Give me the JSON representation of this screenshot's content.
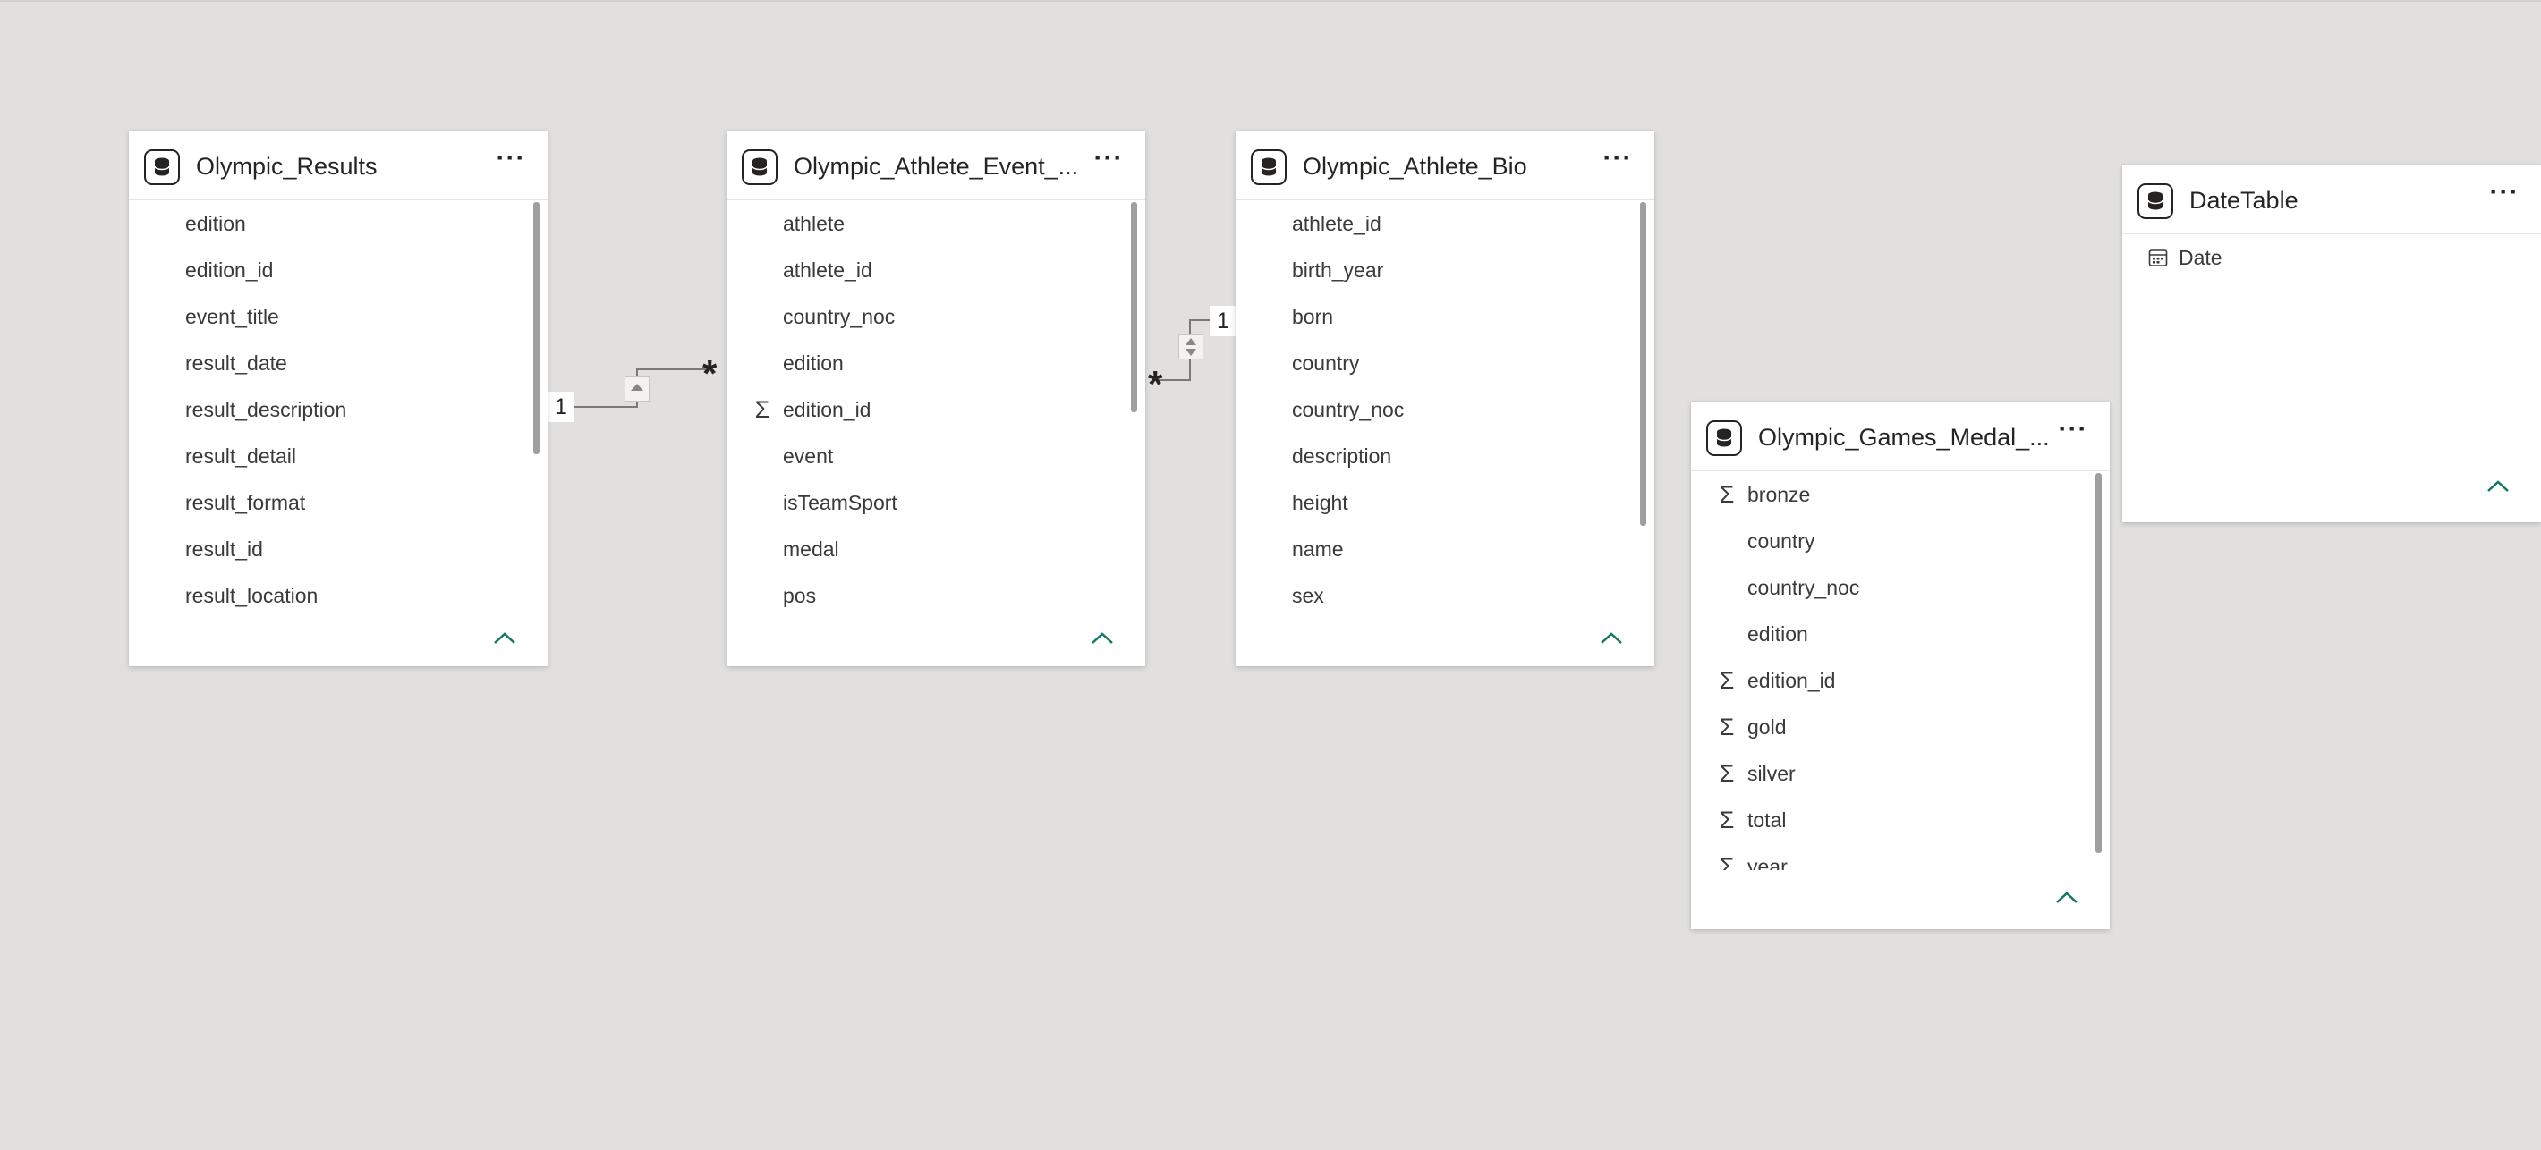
{
  "tables": [
    {
      "title": "Olympic_Results",
      "icon": "table-icon",
      "fields": [
        {
          "name": "edition",
          "icon": ""
        },
        {
          "name": "edition_id",
          "icon": ""
        },
        {
          "name": "event_title",
          "icon": ""
        },
        {
          "name": "result_date",
          "icon": ""
        },
        {
          "name": "result_description",
          "icon": ""
        },
        {
          "name": "result_detail",
          "icon": ""
        },
        {
          "name": "result_format",
          "icon": ""
        },
        {
          "name": "result_id",
          "icon": ""
        },
        {
          "name": "result_location",
          "icon": ""
        }
      ]
    },
    {
      "title": "Olympic_Athlete_Event_...",
      "icon": "table-icon",
      "fields": [
        {
          "name": "athlete",
          "icon": ""
        },
        {
          "name": "athlete_id",
          "icon": ""
        },
        {
          "name": "country_noc",
          "icon": ""
        },
        {
          "name": "edition",
          "icon": ""
        },
        {
          "name": "edition_id",
          "icon": "Σ"
        },
        {
          "name": "event",
          "icon": ""
        },
        {
          "name": "isTeamSport",
          "icon": ""
        },
        {
          "name": "medal",
          "icon": ""
        },
        {
          "name": "pos",
          "icon": ""
        }
      ]
    },
    {
      "title": "Olympic_Athlete_Bio",
      "icon": "table-icon",
      "fields": [
        {
          "name": "athlete_id",
          "icon": ""
        },
        {
          "name": "birth_year",
          "icon": ""
        },
        {
          "name": "born",
          "icon": ""
        },
        {
          "name": "country",
          "icon": ""
        },
        {
          "name": "country_noc",
          "icon": ""
        },
        {
          "name": "description",
          "icon": ""
        },
        {
          "name": "height",
          "icon": ""
        },
        {
          "name": "name",
          "icon": ""
        },
        {
          "name": "sex",
          "icon": ""
        }
      ]
    },
    {
      "title": "Olympic_Games_Medal_...",
      "icon": "table-icon",
      "fields": [
        {
          "name": "bronze",
          "icon": "Σ"
        },
        {
          "name": "country",
          "icon": ""
        },
        {
          "name": "country_noc",
          "icon": ""
        },
        {
          "name": "edition",
          "icon": ""
        },
        {
          "name": "edition_id",
          "icon": "Σ"
        },
        {
          "name": "gold",
          "icon": "Σ"
        },
        {
          "name": "silver",
          "icon": "Σ"
        },
        {
          "name": "total",
          "icon": "Σ"
        },
        {
          "name": "year",
          "icon": "Σ"
        }
      ]
    },
    {
      "title": "DateTable",
      "icon": "table-icon",
      "fields": [
        {
          "name": "Date",
          "icon": "calendar"
        }
      ]
    }
  ],
  "more_label": "···",
  "relationships": [
    {
      "from_cardinality": "1",
      "to_cardinality": "*"
    },
    {
      "from_cardinality": "*",
      "to_cardinality": "1"
    }
  ],
  "colors": {
    "canvas": "#e1e0df",
    "card": "#ffffff",
    "accent": "#117865",
    "line": "#7a7978"
  }
}
